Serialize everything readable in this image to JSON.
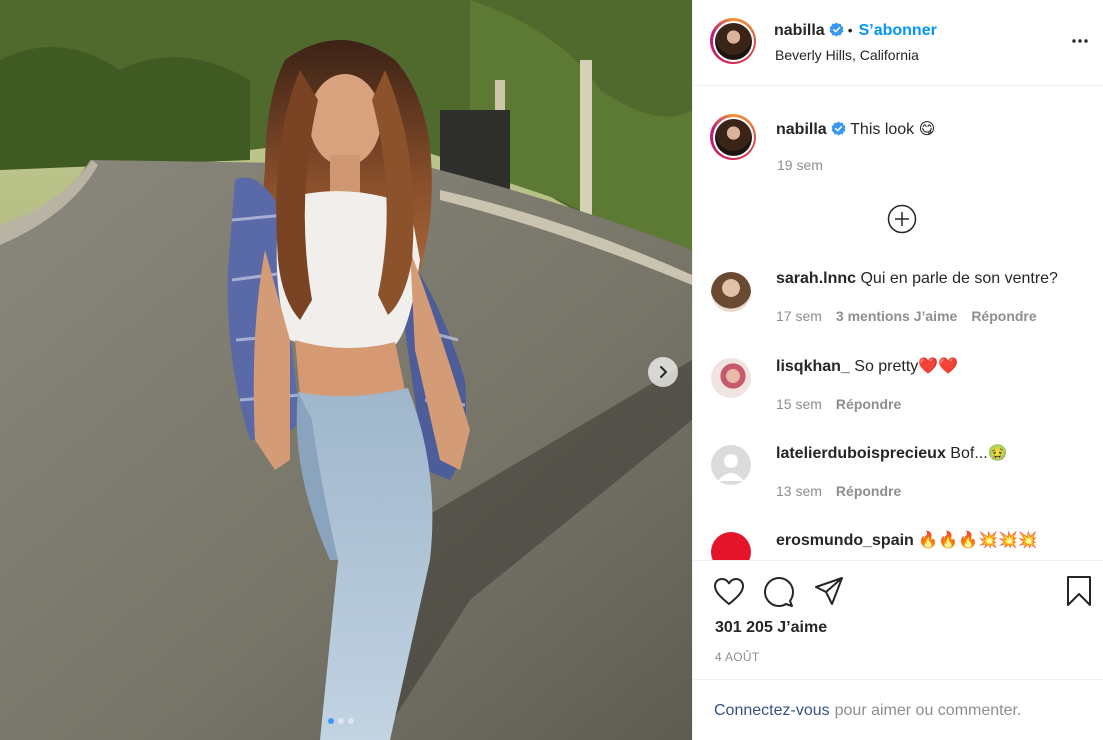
{
  "post": {
    "username": "nabilla",
    "follow_label": "S’abonner",
    "location": "Beverly Hills, California",
    "caption": "This look 😋",
    "caption_age": "19 sem",
    "likes": "301 205 J’aime",
    "date": "4 AOÛT",
    "login_link": "Connectez-vous",
    "login_text": "pour aimer ou commenter.",
    "carousel": {
      "total": 3,
      "active": 1
    }
  },
  "comments": [
    {
      "username": "sarah.lnnc",
      "text": "Qui en parle de son ventre?",
      "age": "17 sem",
      "likes_label": "3 mentions J’aime",
      "reply": "Répondre"
    },
    {
      "username": "lisqkhan_",
      "text": "So pretty❤️❤️",
      "age": "15 sem",
      "likes_label": "",
      "reply": "Répondre"
    },
    {
      "username": "latelierduboisprecieux",
      "text": "Bof...🤢",
      "age": "13 sem",
      "likes_label": "",
      "reply": "Répondre"
    },
    {
      "username": "erosmundo_spain",
      "text": "🔥🔥🔥💥💥💥",
      "age": "",
      "likes_label": "",
      "reply": ""
    }
  ],
  "colors": {
    "accent": "#0095f6",
    "link": "#385185",
    "muted": "#8e8e8e",
    "text": "#262626",
    "carousel_dot": "#3d97f0"
  },
  "icons": [
    "verified-badge-icon",
    "more-options-icon",
    "load-more-icon",
    "heart-icon",
    "comment-icon",
    "share-icon",
    "bookmark-icon",
    "chevron-right-icon"
  ]
}
